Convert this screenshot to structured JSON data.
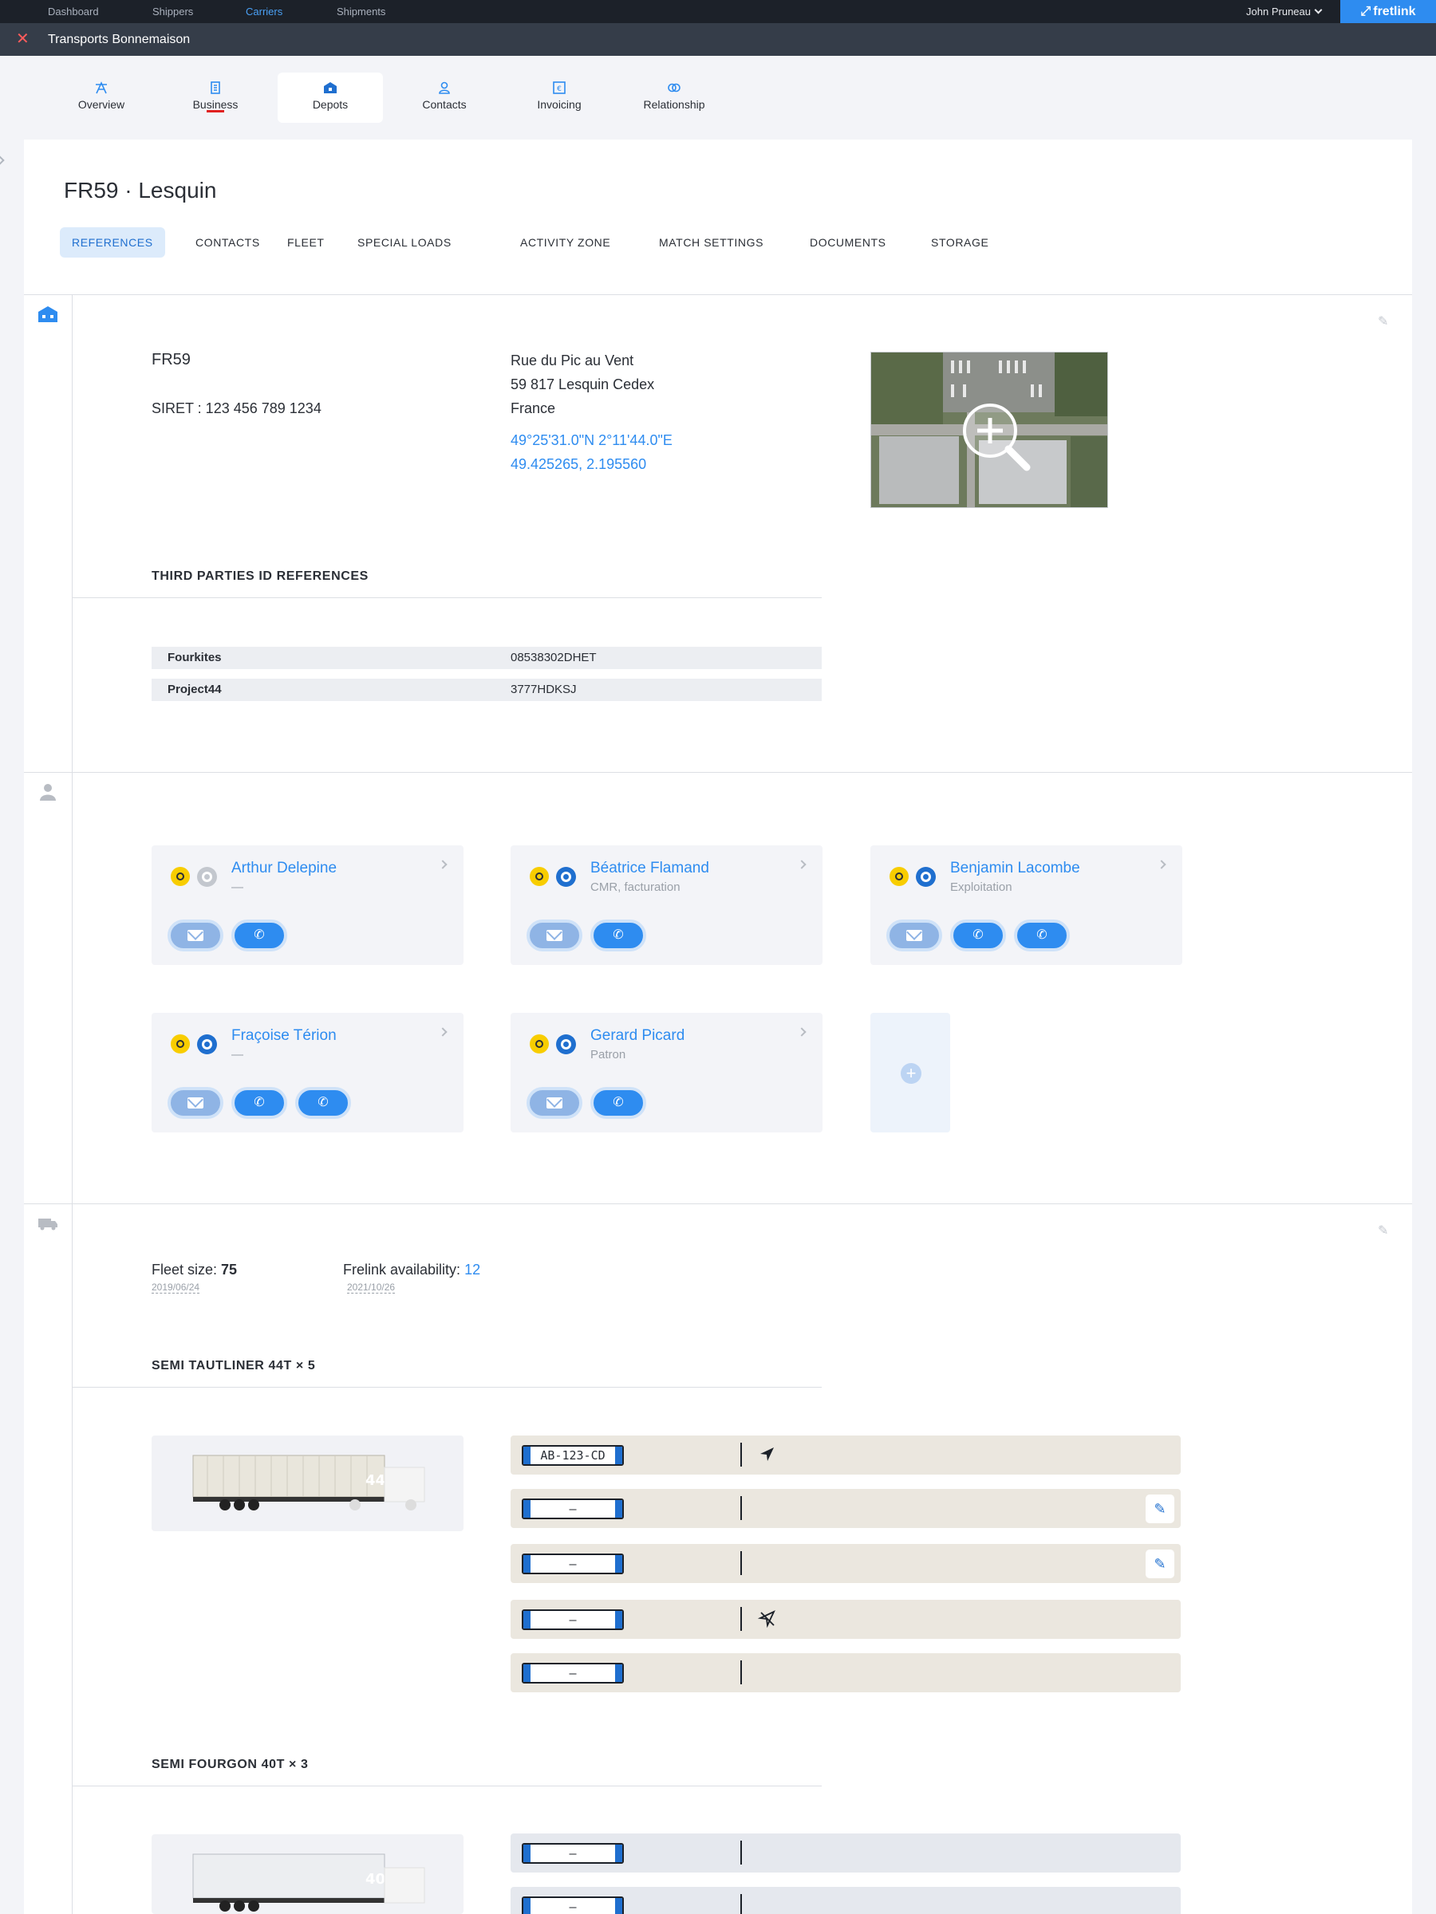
{
  "topnav": {
    "items": [
      "Dashboard",
      "Shippers",
      "Carriers",
      "Shipments"
    ],
    "active": "Carriers",
    "user": "John Pruneau",
    "brand": "fretlink"
  },
  "subbar": {
    "title": "Transports Bonnemaison",
    "close": "✕"
  },
  "module_tabs": [
    "Overview",
    "Business",
    "Depots",
    "Contacts",
    "Invoicing",
    "Relationship"
  ],
  "page": {
    "title": "FR59 · Lesquin",
    "subtabs": [
      "REFERENCES",
      "CONTACTS",
      "FLEET",
      "SPECIAL LOADS",
      "ACTIVITY ZONE",
      "MATCH SETTINGS",
      "DOCUMENTS",
      "STORAGE"
    ]
  },
  "depot": {
    "code": "FR59",
    "siret": "SIRET : 123 456 789 1234",
    "address_line1": "Rue du Pic au Vent",
    "address_line2": "59 817 Lesquin Cedex",
    "country": "France",
    "coords_dms": "49°25'31.0\"N 2°11'44.0\"E",
    "coords_dec": "49.425265, 2.195560"
  },
  "third_parties": {
    "heading": "THIRD PARTIES ID REFERENCES",
    "rows": [
      {
        "name": "Fourkites",
        "id": "08538302DHET"
      },
      {
        "name": "Project44",
        "id": "3777HDKSJ"
      }
    ]
  },
  "contacts": [
    {
      "name": "Arthur Delepine",
      "role": "—"
    },
    {
      "name": "Béatrice Flamand",
      "role": "CMR, facturation"
    },
    {
      "name": "Benjamin Lacombe",
      "role": "Exploitation"
    },
    {
      "name": "Fraçoise Térion",
      "role": "—"
    },
    {
      "name": "Gerard Picard",
      "role": "Patron"
    }
  ],
  "fleet": {
    "size_label": "Fleet size: ",
    "size_value": "75",
    "size_date": "2019/06/24",
    "avail_label": "Frelink availability: ",
    "avail_value": "12",
    "avail_date": "2021/10/26",
    "group1": {
      "heading": "SEMI TAUTLINER 44T × 5",
      "badge": "44t",
      "plates": [
        "AB-123-CD",
        "–",
        "–",
        "–",
        "–"
      ]
    },
    "group2": {
      "heading": "SEMI FOURGON 40T × 3",
      "badge": "40t",
      "plates": [
        "–",
        "–"
      ]
    }
  },
  "colors": {
    "accent": "#2e8cf0",
    "topbar": "#1c2129",
    "subbar": "#353d49",
    "warning": "#f8cd00"
  }
}
